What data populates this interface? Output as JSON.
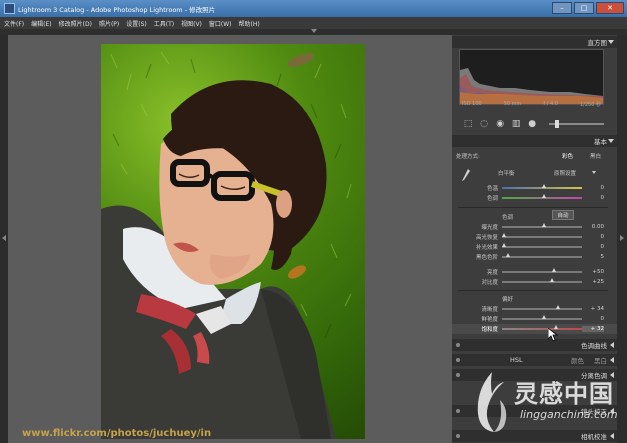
{
  "window": {
    "title": "Lightroom 3 Catalog - Adobe Photoshop Lightroom - 修改照片",
    "buttons": [
      "–",
      "□",
      "✕"
    ]
  },
  "menu": [
    "文件(F)",
    "编辑(E)",
    "修改照片(D)",
    "照片(P)",
    "设置(S)",
    "工具(T)",
    "视图(V)",
    "窗口(W)",
    "帮助(H)"
  ],
  "histogram": {
    "title": "直方图",
    "info": [
      "ISO 100",
      "50 mm",
      "f / 4.0",
      "1/250 秒"
    ]
  },
  "basic": {
    "title": "基本",
    "treatment_label": "处理方式:",
    "treatment_color": "彩色",
    "treatment_bw": "黑白",
    "wb_label": "白平衡",
    "wb_value": "原照设置",
    "temp_label": "色温",
    "temp_value": "0",
    "tint_label": "色调",
    "tint_value": "0",
    "tone_label": "色调",
    "auto_label": "自动",
    "exposure_label": "曝光度",
    "exposure_value": "0.00",
    "recovery_label": "高光恢复",
    "recovery_value": "0",
    "fill_label": "补光效果",
    "fill_value": "0",
    "blacks_label": "黑色色阶",
    "blacks_value": "5",
    "brightness_label": "亮度",
    "brightness_value": "+50",
    "contrast_label": "对比度",
    "contrast_value": "+25",
    "presence_label": "偏好",
    "clarity_label": "清晰度",
    "clarity_value": "+ 34",
    "vibrance_label": "鲜艳度",
    "vibrance_value": "0",
    "saturation_label": "饱和度",
    "saturation_value": "+ 32"
  },
  "tone_curve": {
    "title": "色调曲线"
  },
  "hsl": {
    "title": "HSL",
    "color": "颜色",
    "bw": "黑白"
  },
  "split": {
    "title": "分离色调"
  },
  "detail": {
    "title": "镜头校正"
  },
  "effects": {
    "title": "相机校准"
  },
  "watermark": "www.flickr.com/photos/juchuey/in",
  "logo": {
    "cn": "灵感中国",
    "en": "lingganchina.com"
  },
  "colors": {
    "accent": "#d0d0d0",
    "panel": "#3d3d3d",
    "canvas": "#5c5c5c"
  }
}
